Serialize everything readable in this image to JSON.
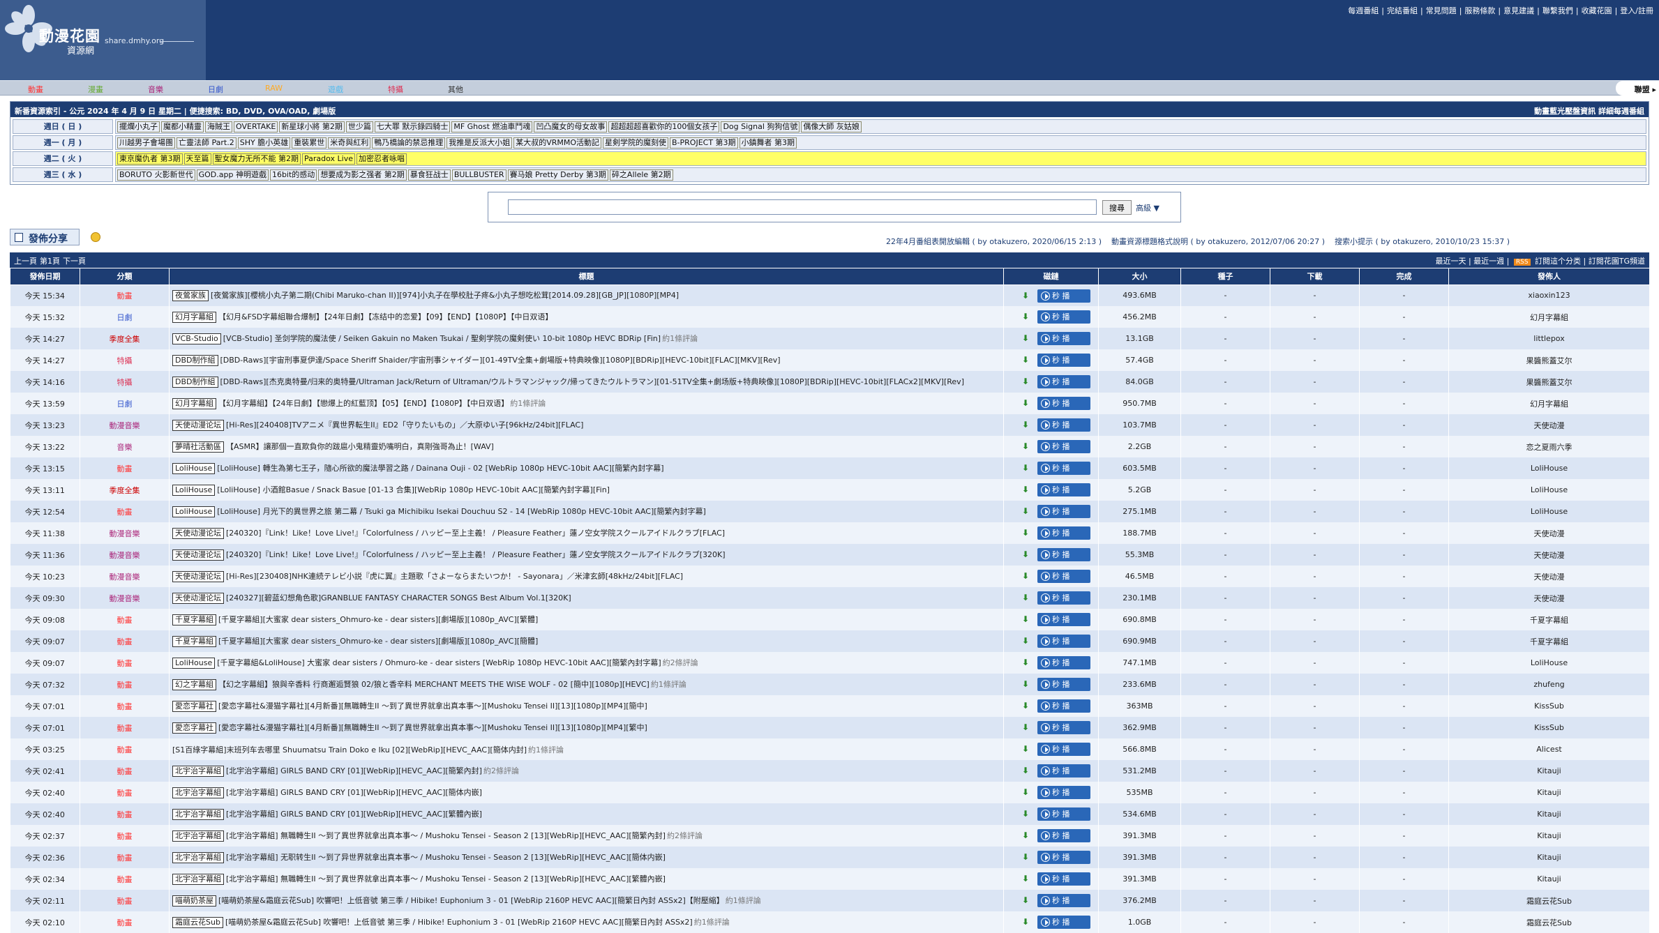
{
  "site": {
    "name": "動漫花園",
    "sub": "資源網",
    "url": "share.dmhy.org"
  },
  "top_links": [
    "每週番組",
    "完結番組",
    "常見問題",
    "服務條款",
    "意見建議",
    "聯繫我們",
    "收藏花園",
    "登入/註冊"
  ],
  "categories": [
    {
      "label": "動畫",
      "color": "#ff3333"
    },
    {
      "label": "漫畫",
      "color": "#66aa33"
    },
    {
      "label": "音樂",
      "color": "#aa2277"
    },
    {
      "label": "日劇",
      "color": "#3355cc"
    },
    {
      "label": "RAW",
      "color": "#ffaa22"
    },
    {
      "label": "遊戲",
      "color": "#55bbee"
    },
    {
      "label": "特攝",
      "color": "#dd3355"
    },
    {
      "label": "其他",
      "color": "#333333"
    }
  ],
  "forum_tab": "聯盟 ▸",
  "schedule": {
    "header_left": "新番資源索引 - 公元 2024 年 4 月 9 日 星期二 | 便捷搜索: BD, DVD, OVA/OAD, 劇場版",
    "header_right": "動畫藍光壓盤資訊  詳細每週番組",
    "days": [
      {
        "day": "週日 ( 日 )",
        "shows": [
          "擺爛小丸子",
          "魔都小精靈",
          "海賊王",
          "OVERTAKE",
          "新星球小將 第2期",
          "世少篇",
          "七大罪 默示錄四騎士",
          "MF Ghost 燃油車鬥魂",
          "凹凸魔女的母女故事",
          "超超超超喜歡你的100個女孩子",
          "Dog Signal 狗狗信號",
          "偶像大師 灰姑娘"
        ],
        "yellow": false
      },
      {
        "day": "週一 ( 月 )",
        "shows": [
          "川越男子會場團",
          "亡靈法師 Part.2",
          "SHY 膽小英雄",
          "重裝累世",
          "米奇與紅利",
          "鴨乃橋論的禁忌推理",
          "我推是反派大小姐",
          "某大叔的VRMMO活動記",
          "星剣学院的魔刻使",
          "B-PROJECT 第3期",
          "小鎮舞者 第3期"
        ],
        "yellow": false
      },
      {
        "day": "週二 ( 火 )",
        "shows": [
          "東京魔仇者 第3期",
          "天至篇",
          "聖女魔力无所不能 第2期",
          "Paradox Live",
          "加密忍者咏唱"
        ],
        "yellow": true
      },
      {
        "day": "週三 ( 水 )",
        "shows": [
          "BORUTO 火影新世代",
          "GOD.app 神明遊戲",
          "16bit的感动",
          "想要成为影之强者 第2期",
          "暴食狂战士",
          "BULLBUSTER",
          "賽马娘 Pretty Derby 第3期",
          "碎之Allele 第2期"
        ],
        "yellow": false
      }
    ]
  },
  "search": {
    "value": "",
    "button": "搜尋",
    "advanced": "高級 ▼"
  },
  "post_button": "發佈分享",
  "notes": [
    "22年4月番組表開放編輯 ( by otakuzero, 2020/06/15 2:13 )",
    "動畫資源標題格式說明 ( by otakuzero, 2012/07/06 20:27 )",
    "搜索小提示 ( by otakuzero, 2010/10/23 15:37 )"
  ],
  "listbar": {
    "left": [
      "上一頁",
      "第1頁",
      "下一頁"
    ],
    "right_a": "最近一天 | 最近一週 |",
    "rss": "RSS",
    "right_b": "訂閱這个分类 | 訂閱花園TG頻道"
  },
  "columns": [
    "發佈日期",
    "分類",
    "標題",
    "磁鏈",
    "大小",
    "種子",
    "下載",
    "完成",
    "發佈人"
  ],
  "play_label": "秒 播",
  "rows": [
    {
      "date": "今天 15:34",
      "cat": "動畫",
      "cat_color": "#ff3333",
      "group": "夜鶯家族",
      "title": "[夜鶯家族][櫻桃小丸子第二期(Chibi Maruko-chan II)][974]小丸子在學校肚子疼&小丸子想吃松茸[2014.09.28][GB_JP][1080P][MP4]",
      "comments": "",
      "size": "493.6MB",
      "seed": "-",
      "dl": "-",
      "done": "-",
      "pub": "xiaoxin123"
    },
    {
      "date": "今天 15:32",
      "cat": "日劇",
      "cat_color": "#3355cc",
      "group": "幻月字幕組",
      "title": "【幻月&FSD字幕組聯合爆制】【24年日劇】【冻结中的恋爱】【09】【END】【1080P】【中日双语】",
      "comments": "",
      "size": "456.2MB",
      "seed": "-",
      "dl": "-",
      "done": "-",
      "pub": "幻月字幕組"
    },
    {
      "date": "今天 14:27",
      "cat": "季度全集",
      "cat_color": "#cc0000",
      "group": "VCB-Studio",
      "title": "[VCB-Studio] 圣剑学院的魔法使 / Seiken Gakuin no Maken Tsukai / 聖剣学院の魔剣使い 10-bit 1080p HEVC BDRip [Fin]",
      "comments": "約1條評論",
      "size": "13.1GB",
      "seed": "-",
      "dl": "-",
      "done": "-",
      "pub": "littlepox"
    },
    {
      "date": "今天 14:27",
      "cat": "特攝",
      "cat_color": "#dd3355",
      "group": "DBD制作組",
      "title": "[DBD-Raws][宇宙刑事夏伊達/Space Sheriff Shaider/宇宙刑事シャイダー][01-49TV全集+劇場版+特典映像][1080P][BDRip][HEVC-10bit][FLAC][MKV][Rev]",
      "comments": "",
      "size": "57.4GB",
      "seed": "-",
      "dl": "-",
      "done": "-",
      "pub": "果醬熊蓋艾尔"
    },
    {
      "date": "今天 14:16",
      "cat": "特攝",
      "cat_color": "#dd3355",
      "group": "DBD制作組",
      "title": "[DBD-Raws][杰克奥特曼/归来的奥特曼/Ultraman Jack/Return of Ultraman/ウルトラマンジャック/帰ってきたウルトラマン][01-51TV全集+劇场版+特典映像][1080P][BDRip][HEVC-10bit][FLACx2][MKV][Rev]",
      "comments": "",
      "size": "84.0GB",
      "seed": "-",
      "dl": "-",
      "done": "-",
      "pub": "果醬熊蓋艾尔"
    },
    {
      "date": "今天 13:59",
      "cat": "日劇",
      "cat_color": "#3355cc",
      "group": "幻月字幕組",
      "title": "【幻月字幕組】【24年日劇】【戀爆上的紅藍顶】【05】【END】【1080P】【中日双语】",
      "comments": "約1條評論",
      "size": "950.7MB",
      "seed": "-",
      "dl": "-",
      "done": "-",
      "pub": "幻月字幕組"
    },
    {
      "date": "今天 13:23",
      "cat": "動漫音樂",
      "cat_color": "#aa2277",
      "group": "天使动漫论坛",
      "title": "[Hi-Res][240408]TVアニメ『異世界転生II』ED2「守りたいもの」／大原ゆい子[96kHz/24bit][FLAC]",
      "comments": "",
      "size": "103.7MB",
      "seed": "-",
      "dl": "-",
      "done": "-",
      "pub": "天使动漫"
    },
    {
      "date": "今天 13:22",
      "cat": "音樂",
      "cat_color": "#aa2277",
      "group": "夢晴社活動區",
      "title": "【ASMR】讓那個一直欺負你的跋扈小鬼精靈奶嘴明白，真剛強哥為止！[WAV]",
      "comments": "",
      "size": "2.2GB",
      "seed": "-",
      "dl": "-",
      "done": "-",
      "pub": "恋之夏雨六季"
    },
    {
      "date": "今天 13:15",
      "cat": "動畫",
      "cat_color": "#ff3333",
      "group": "LoliHouse",
      "title": "[LoliHouse] 轉生為第七王子，隨心所欲的魔法學習之路 / Dainana Ouji - 02 [WebRip 1080p HEVC-10bit AAC][簡繁內封字幕]",
      "comments": "",
      "size": "603.5MB",
      "seed": "-",
      "dl": "-",
      "done": "-",
      "pub": "LoliHouse"
    },
    {
      "date": "今天 13:11",
      "cat": "季度全集",
      "cat_color": "#cc0000",
      "group": "LoliHouse",
      "title": "[LoliHouse] 小酒館Basue / Snack Basue [01-13 合集][WebRip 1080p HEVC-10bit AAC][簡繁內封字幕][Fin]",
      "comments": "",
      "size": "5.2GB",
      "seed": "-",
      "dl": "-",
      "done": "-",
      "pub": "LoliHouse"
    },
    {
      "date": "今天 12:54",
      "cat": "動畫",
      "cat_color": "#ff3333",
      "group": "LoliHouse",
      "title": "[LoliHouse] 月光下的異世界之旅 第二幕 / Tsuki ga Michibiku Isekai Douchuu S2 - 14 [WebRip 1080p HEVC-10bit AAC][簡繁內封字幕]",
      "comments": "",
      "size": "275.1MB",
      "seed": "-",
      "dl": "-",
      "done": "-",
      "pub": "LoliHouse"
    },
    {
      "date": "今天 11:38",
      "cat": "動漫音樂",
      "cat_color": "#aa2277",
      "group": "天使动漫论坛",
      "title": "[240320]『Link！Like！Love Live!』「Colorfulness / ハッピー至上主義！ / Pleasure Feather」蓮ノ空女学院スクールアイドルクラブ[FLAC]",
      "comments": "",
      "size": "188.7MB",
      "seed": "-",
      "dl": "-",
      "done": "-",
      "pub": "天使动漫"
    },
    {
      "date": "今天 11:36",
      "cat": "動漫音樂",
      "cat_color": "#aa2277",
      "group": "天使动漫论坛",
      "title": "[240320]『Link！Like！Love Live!』「Colorfulness / ハッピー至上主義！ / Pleasure Feather」蓮ノ空女学院スクールアイドルクラブ[320K]",
      "comments": "",
      "size": "55.3MB",
      "seed": "-",
      "dl": "-",
      "done": "-",
      "pub": "天使动漫"
    },
    {
      "date": "今天 10:23",
      "cat": "動漫音樂",
      "cat_color": "#aa2277",
      "group": "天使动漫论坛",
      "title": "[Hi-Res][230408]NHK連続テレビ小説『虎に翼』主題歌「さよーならまたいつか！ - Sayonara」／米津玄師[48kHz/24bit][FLAC]",
      "comments": "",
      "size": "46.5MB",
      "seed": "-",
      "dl": "-",
      "done": "-",
      "pub": "天使动漫"
    },
    {
      "date": "今天 09:30",
      "cat": "動漫音樂",
      "cat_color": "#aa2277",
      "group": "天使动漫论坛",
      "title": "[240327][碧蓝幻想角色歌]GRANBLUE FANTASY CHARACTER SONGS Best Album Vol.1[320K]",
      "comments": "",
      "size": "230.1MB",
      "seed": "-",
      "dl": "-",
      "done": "-",
      "pub": "天使动漫"
    },
    {
      "date": "今天 09:08",
      "cat": "動畫",
      "cat_color": "#ff3333",
      "group": "千夏字幕組",
      "title": "[千夏字幕組][大蜜家 dear sisters_Ohmuro-ke - dear sisters][劇場版][1080p_AVC][繁體]",
      "comments": "",
      "size": "690.8MB",
      "seed": "-",
      "dl": "-",
      "done": "-",
      "pub": "千夏字幕組"
    },
    {
      "date": "今天 09:07",
      "cat": "動畫",
      "cat_color": "#ff3333",
      "group": "千夏字幕組",
      "title": "[千夏字幕組][大蜜家 dear sisters_Ohmuro-ke - dear sisters][劇場版][1080p_AVC][簡體]",
      "comments": "",
      "size": "690.9MB",
      "seed": "-",
      "dl": "-",
      "done": "-",
      "pub": "千夏字幕組"
    },
    {
      "date": "今天 09:07",
      "cat": "動畫",
      "cat_color": "#ff3333",
      "group": "LoliHouse",
      "title": "[千夏字幕組&LoliHouse] 大蜜家 dear sisters / Ohmuro-ke - dear sisters [WebRip 1080p HEVC-10bit AAC][簡繁內封字幕]",
      "comments": "約2條評論",
      "size": "747.1MB",
      "seed": "-",
      "dl": "-",
      "done": "-",
      "pub": "LoliHouse"
    },
    {
      "date": "今天 07:32",
      "cat": "動畫",
      "cat_color": "#ff3333",
      "group": "幻之字幕組",
      "title": "【幻之字幕組】狼與辛香料 行商邂逅賢狼 02/狼と香辛料 MERCHANT MEETS THE WISE WOLF - 02 [簡中][1080p][HEVC]",
      "comments": "約1條評論",
      "size": "233.6MB",
      "seed": "-",
      "dl": "-",
      "done": "-",
      "pub": "zhufeng"
    },
    {
      "date": "今天 07:01",
      "cat": "動畫",
      "cat_color": "#ff3333",
      "group": "愛恋字幕社",
      "title": "[愛恋字幕社&漫猫字幕社][4月新番][無職轉生II ～到了異世界就拿出真本事～][Mushoku Tensei II][13][1080p][MP4][簡中]",
      "comments": "",
      "size": "363MB",
      "seed": "-",
      "dl": "-",
      "done": "-",
      "pub": "KissSub"
    },
    {
      "date": "今天 07:01",
      "cat": "動畫",
      "cat_color": "#ff3333",
      "group": "愛恋字幕社",
      "title": "[愛恋字幕社&漫猫字幕社][4月新番][無職轉生II ～到了異世界就拿出真本事～][Mushoku Tensei II][13][1080p][MP4][繁中]",
      "comments": "",
      "size": "362.9MB",
      "seed": "-",
      "dl": "-",
      "done": "-",
      "pub": "KissSub"
    },
    {
      "date": "今天 03:25",
      "cat": "動畫",
      "cat_color": "#ff3333",
      "group": "",
      "title": "[S1百綠字幕組]末班列车去哪里 Shuumatsu Train Doko e Iku [02][WebRip][HEVC_AAC][簡体内封]",
      "comments": "約1條評論",
      "size": "566.8MB",
      "seed": "-",
      "dl": "-",
      "done": "-",
      "pub": "Alicest"
    },
    {
      "date": "今天 02:41",
      "cat": "動畫",
      "cat_color": "#ff3333",
      "group": "北宇治字幕組",
      "title": "[北宇治字幕組] GIRLS BAND CRY [01][WebRip][HEVC_AAC][簡繁內封]",
      "comments": "約2條評論",
      "size": "531.2MB",
      "seed": "-",
      "dl": "-",
      "done": "-",
      "pub": "Kitauji"
    },
    {
      "date": "今天 02:40",
      "cat": "動畫",
      "cat_color": "#ff3333",
      "group": "北宇治字幕組",
      "title": "[北宇治字幕組] GIRLS BAND CRY [01][WebRip][HEVC_AAC][簡体内嵌]",
      "comments": "",
      "size": "535MB",
      "seed": "-",
      "dl": "-",
      "done": "-",
      "pub": "Kitauji"
    },
    {
      "date": "今天 02:40",
      "cat": "動畫",
      "cat_color": "#ff3333",
      "group": "北宇治字幕組",
      "title": "[北宇治字幕組] GIRLS BAND CRY [01][WebRip][HEVC_AAC][繁體內嵌]",
      "comments": "",
      "size": "534.6MB",
      "seed": "-",
      "dl": "-",
      "done": "-",
      "pub": "Kitauji"
    },
    {
      "date": "今天 02:37",
      "cat": "動畫",
      "cat_color": "#ff3333",
      "group": "北宇治字幕組",
      "title": "[北宇治字幕組] 無職轉生II ～到了異世界就拿出真本事～ / Mushoku Tensei - Season 2 [13][WebRip][HEVC_AAC][簡繁內封]",
      "comments": "約2條評論",
      "size": "391.3MB",
      "seed": "-",
      "dl": "-",
      "done": "-",
      "pub": "Kitauji"
    },
    {
      "date": "今天 02:36",
      "cat": "動畫",
      "cat_color": "#ff3333",
      "group": "北宇治字幕組",
      "title": "[北宇治字幕組] 无职转生II ～到了异世界就拿出真本事～ / Mushoku Tensei - Season 2 [13][WebRip][HEVC_AAC][簡体内嵌]",
      "comments": "",
      "size": "391.3MB",
      "seed": "-",
      "dl": "-",
      "done": "-",
      "pub": "Kitauji"
    },
    {
      "date": "今天 02:34",
      "cat": "動畫",
      "cat_color": "#ff3333",
      "group": "北宇治字幕組",
      "title": "[北宇治字幕組] 無職轉生II ～到了異世界就拿出真本事～ / Mushoku Tensei - Season 2 [13][WebRip][HEVC_AAC][繁體內嵌]",
      "comments": "",
      "size": "391.3MB",
      "seed": "-",
      "dl": "-",
      "done": "-",
      "pub": "Kitauji"
    },
    {
      "date": "今天 02:11",
      "cat": "動畫",
      "cat_color": "#ff3333",
      "group": "喵萌奶茶屋",
      "title": "[喵萌奶茶屋&霜庭云花Sub] 吹響吧！上低音號 第三季 / Hibike! Euphonium 3 - 01 [WebRip 2160P HEVC AAC][簡繁日內封 ASSx2]【附壓縮】",
      "comments": "約1條評論",
      "size": "376.2MB",
      "seed": "-",
      "dl": "-",
      "done": "-",
      "pub": "霜庭云花Sub"
    },
    {
      "date": "今天 02:10",
      "cat": "動畫",
      "cat_color": "#ff3333",
      "group": "霜庭云花Sub",
      "title": "[喵萌奶茶屋&霜庭云花Sub] 吹響吧！上低音號 第三季 / Hibike! Euphonium 3 - 01 [WebRip 2160P HEVC AAC][簡繁日內封 ASSx2]",
      "comments": "約1條評論",
      "size": "1.0GB",
      "seed": "-",
      "dl": "-",
      "done": "-",
      "pub": "霜庭云花Sub"
    }
  ]
}
